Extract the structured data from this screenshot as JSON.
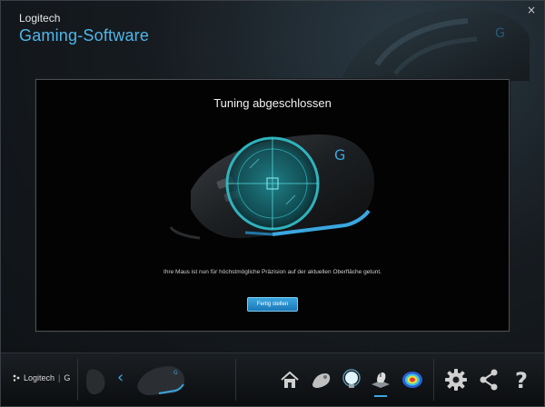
{
  "app": {
    "brand_small": "Logitech",
    "brand_large": "Gaming-Software",
    "close_glyph": "×"
  },
  "panel": {
    "title": "Tuning abgeschlossen",
    "message": "Ihre Maus ist nun für höchstmögliche Präzision auf der aktuellen Oberfläche getunt.",
    "finish_button": "Fertig stellen"
  },
  "bottom_bar": {
    "logo_text": "Logitech",
    "logo_g": "G",
    "back_glyph": "‹",
    "icons": [
      "home-icon",
      "pointer-settings-icon",
      "lighting-icon",
      "surface-tuning-icon",
      "heatmap-icon",
      "gear-icon",
      "share-icon",
      "help-icon"
    ]
  },
  "colors": {
    "accent": "#3aa7e0",
    "brand_blue": "#4fb6e8",
    "panel_bg": "#030303"
  }
}
